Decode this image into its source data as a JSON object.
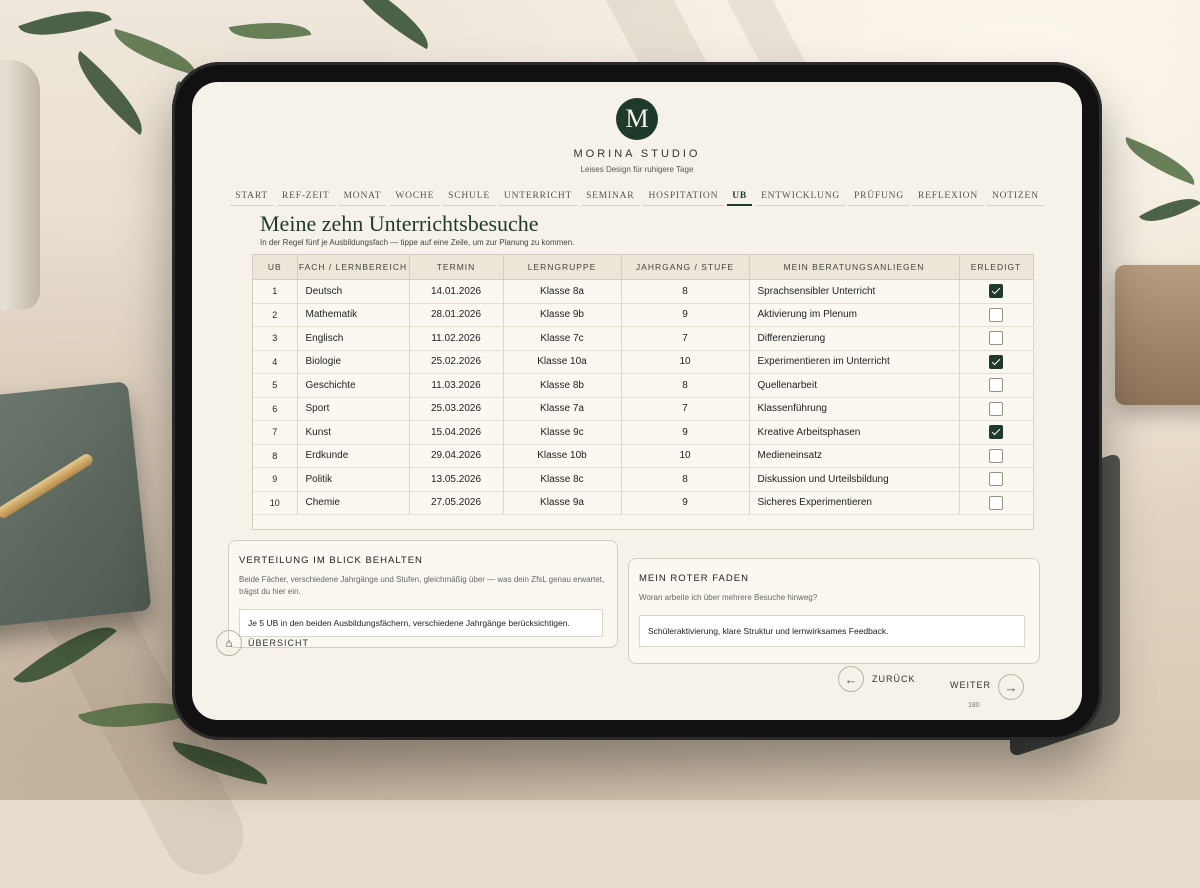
{
  "brand": {
    "logo_letter": "M",
    "name": "MORINA STUDIO",
    "tagline": "Leises Design für ruhigere Tage"
  },
  "nav": {
    "tabs": [
      "START",
      "REF-ZEIT",
      "MONAT",
      "WOCHE",
      "SCHULE",
      "UNTERRICHT",
      "SEMINAR",
      "HOSPITATION",
      "UB",
      "ENTWICKLUNG",
      "PRÜFUNG",
      "REFLEXION",
      "NOTIZEN"
    ],
    "active": "UB"
  },
  "page": {
    "title": "Meine zehn Unterrichtsbesuche",
    "subtitle": "In der Regel fünf je Ausbildungsfach — tippe auf eine Zeile, um zur Planung zu kommen."
  },
  "table": {
    "headers": [
      "UB",
      "FACH / LERNBEREICH",
      "TERMIN",
      "LERNGRUPPE",
      "JAHRGANG / STUFE",
      "MEIN BERATUNGSANLIEGEN",
      "ERLEDIGT"
    ],
    "rows": [
      {
        "ub": "1",
        "fach": "Deutsch",
        "termin": "14.01.2026",
        "gruppe": "Klasse 8a",
        "jahrgang": "8",
        "anliegen": "Sprachsensibler Unterricht",
        "done": true
      },
      {
        "ub": "2",
        "fach": "Mathematik",
        "termin": "28.01.2026",
        "gruppe": "Klasse 9b",
        "jahrgang": "9",
        "anliegen": "Aktivierung im Plenum",
        "done": false
      },
      {
        "ub": "3",
        "fach": "Englisch",
        "termin": "11.02.2026",
        "gruppe": "Klasse 7c",
        "jahrgang": "7",
        "anliegen": "Differenzierung",
        "done": false
      },
      {
        "ub": "4",
        "fach": "Biologie",
        "termin": "25.02.2026",
        "gruppe": "Klasse 10a",
        "jahrgang": "10",
        "anliegen": "Experimentieren im Unterricht",
        "done": true
      },
      {
        "ub": "5",
        "fach": "Geschichte",
        "termin": "11.03.2026",
        "gruppe": "Klasse 8b",
        "jahrgang": "8",
        "anliegen": "Quellenarbeit",
        "done": false
      },
      {
        "ub": "6",
        "fach": "Sport",
        "termin": "25.03.2026",
        "gruppe": "Klasse 7a",
        "jahrgang": "7",
        "anliegen": "Klassenführung",
        "done": false
      },
      {
        "ub": "7",
        "fach": "Kunst",
        "termin": "15.04.2026",
        "gruppe": "Klasse 9c",
        "jahrgang": "9",
        "anliegen": "Kreative Arbeitsphasen",
        "done": true
      },
      {
        "ub": "8",
        "fach": "Erdkunde",
        "termin": "29.04.2026",
        "gruppe": "Klasse 10b",
        "jahrgang": "10",
        "anliegen": "Medieneinsatz",
        "done": false
      },
      {
        "ub": "9",
        "fach": "Politik",
        "termin": "13.05.2026",
        "gruppe": "Klasse 8c",
        "jahrgang": "8",
        "anliegen": "Diskussion und Urteilsbildung",
        "done": false
      },
      {
        "ub": "10",
        "fach": "Chemie",
        "termin": "27.05.2026",
        "gruppe": "Klasse 9a",
        "jahrgang": "9",
        "anliegen": "Sicheres Experimentieren",
        "done": false
      }
    ]
  },
  "card_left": {
    "title": "VERTEILUNG IM BLICK BEHALTEN",
    "description": "Beide Fächer, verschiedene Jahrgänge und Stufen, gleichmäßig über — was dein ZfsL genau erwartet, trägst du hier ein.",
    "value": "Je 5 UB in den beiden Ausbildungsfächern, verschiedene Jahrgänge berücksichtigen."
  },
  "card_right": {
    "title": "MEIN ROTER FADEN",
    "description": "Woran arbeite ich über mehrere Besuche hinweg?",
    "value": "Schüleraktivierung, klare Struktur und lernwirksames Feedback."
  },
  "footer": {
    "home_label": "ÜBERSICHT",
    "back_label": "ZURÜCK",
    "next_label": "WEITER",
    "page_number": "180"
  },
  "icons": {
    "home": "home-icon",
    "back": "arrow-left-icon",
    "next": "arrow-right-icon",
    "checkbox": "checkbox-icon"
  },
  "colors": {
    "accent": "#1f3a2b",
    "screen_bg": "#f6f2e9",
    "header_bg": "#ece5d8",
    "border": "#d6cdbd"
  }
}
